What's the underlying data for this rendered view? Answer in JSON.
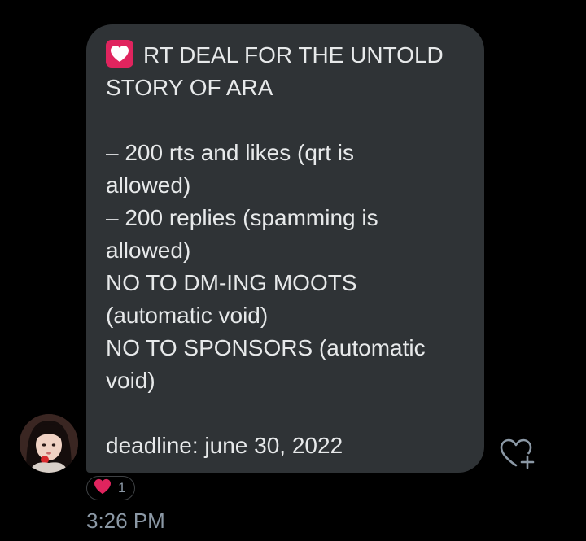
{
  "message": {
    "title_line1": "RT DEAL FOR THE UNTOLD",
    "title_line2": "STORY OF ARA",
    "body_lines": [
      "– 200 rts and likes (qrt is",
      "allowed)",
      "– 200 replies (spamming is",
      "allowed)",
      "NO TO DM-ING MOOTS",
      "(automatic void)",
      "NO TO SPONSORS (automatic",
      "void)"
    ],
    "deadline": "deadline: june 30, 2022",
    "emoji_icon": "heart-emoji-icon"
  },
  "reaction": {
    "icon": "heart-icon",
    "count": "1",
    "color": "#e0245e"
  },
  "timestamp": "3:26 PM",
  "colors": {
    "background": "#000000",
    "bubble": "#2f3336",
    "text": "#e7e9ea",
    "muted": "#8b98a5",
    "accent": "#e0245e"
  }
}
